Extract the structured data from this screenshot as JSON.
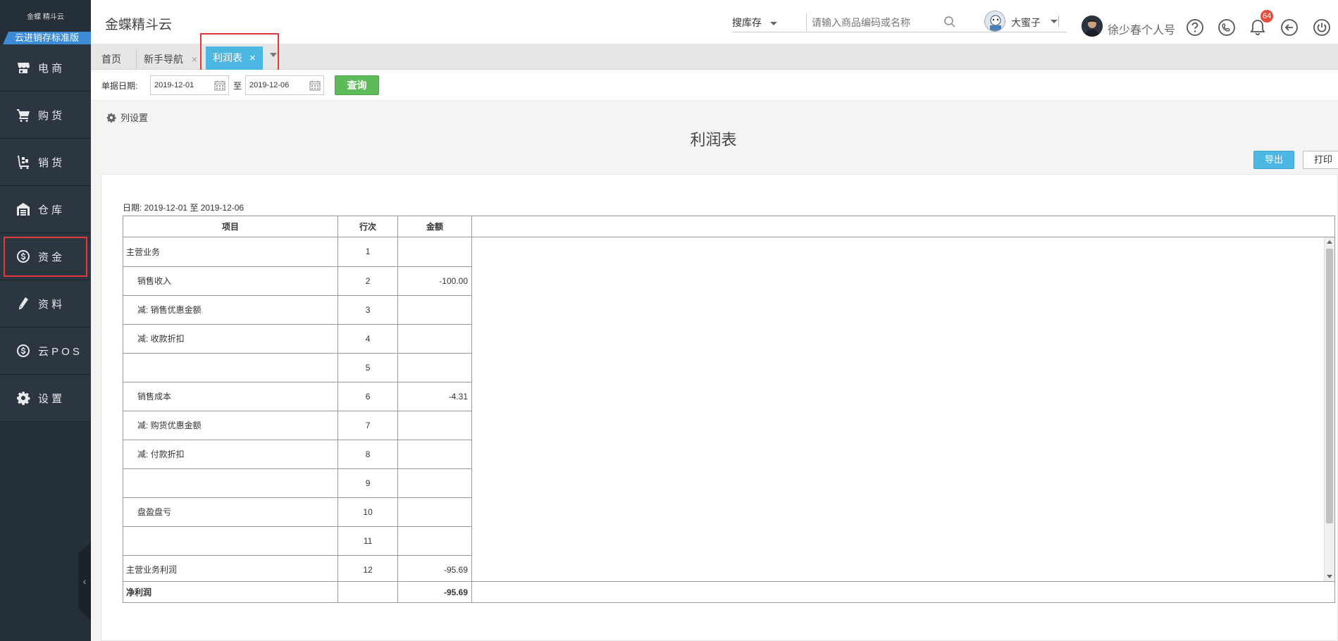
{
  "sidebar": {
    "logo_text": "金蝶 精斗云",
    "edition": "云进销存标准版",
    "items": [
      {
        "label": "电 商",
        "icon": "store-icon"
      },
      {
        "label": "购 货",
        "icon": "cart-icon"
      },
      {
        "label": "销 货",
        "icon": "trolley-icon"
      },
      {
        "label": "仓 库",
        "icon": "warehouse-icon"
      },
      {
        "label": "资 金",
        "icon": "dollar-icon"
      },
      {
        "label": "资 料",
        "icon": "pencil-icon"
      },
      {
        "label": "云 P O S",
        "icon": "dollar-icon"
      },
      {
        "label": "设 置",
        "icon": "gear-icon"
      }
    ],
    "collapse_glyph": "‹"
  },
  "header": {
    "app_title": "金蝶精斗云",
    "search_type": "搜库存",
    "search_placeholder": "请输入商品编码或名称",
    "store_name": "大蜜子",
    "user_name": "徐少春个人号",
    "notification_count": "64"
  },
  "tabs": [
    {
      "label": "首页"
    },
    {
      "label": "新手导航",
      "close": "×"
    },
    {
      "label": "利润表",
      "close": "×"
    }
  ],
  "filter": {
    "date_label": "单据日期:",
    "date_from": "2019-12-01",
    "date_sep": "至",
    "date_to": "2019-12-06",
    "query_label": "查询"
  },
  "report": {
    "column_settings_label": "列设置",
    "title": "利润表",
    "export_label": "导出",
    "print_label": "打印",
    "date_range_text": "日期: 2019-12-01 至 2019-12-06",
    "columns": {
      "item": "项目",
      "line": "行次",
      "amount": "金额"
    },
    "rows": [
      {
        "item": "主营业务",
        "line": "1",
        "amount": "",
        "indent": false
      },
      {
        "item": "销售收入",
        "line": "2",
        "amount": "-100.00",
        "indent": true
      },
      {
        "item": "减: 销售优惠金额",
        "line": "3",
        "amount": "",
        "indent": true
      },
      {
        "item": "减: 收款折扣",
        "line": "4",
        "amount": "",
        "indent": true
      },
      {
        "item": "",
        "line": "5",
        "amount": "",
        "indent": true
      },
      {
        "item": "销售成本",
        "line": "6",
        "amount": "-4.31",
        "indent": true
      },
      {
        "item": "减: 购货优惠金额",
        "line": "7",
        "amount": "",
        "indent": true
      },
      {
        "item": "减: 付款折扣",
        "line": "8",
        "amount": "",
        "indent": true
      },
      {
        "item": "",
        "line": "9",
        "amount": "",
        "indent": true
      },
      {
        "item": "盘盈盘亏",
        "line": "10",
        "amount": "",
        "indent": true
      },
      {
        "item": "",
        "line": "11",
        "amount": "",
        "indent": true
      },
      {
        "item": "主营业务利润",
        "line": "12",
        "amount": "-95.69",
        "indent": false
      }
    ],
    "footer": {
      "item": "净利润",
      "line": "",
      "amount": "-95.69"
    }
  }
}
